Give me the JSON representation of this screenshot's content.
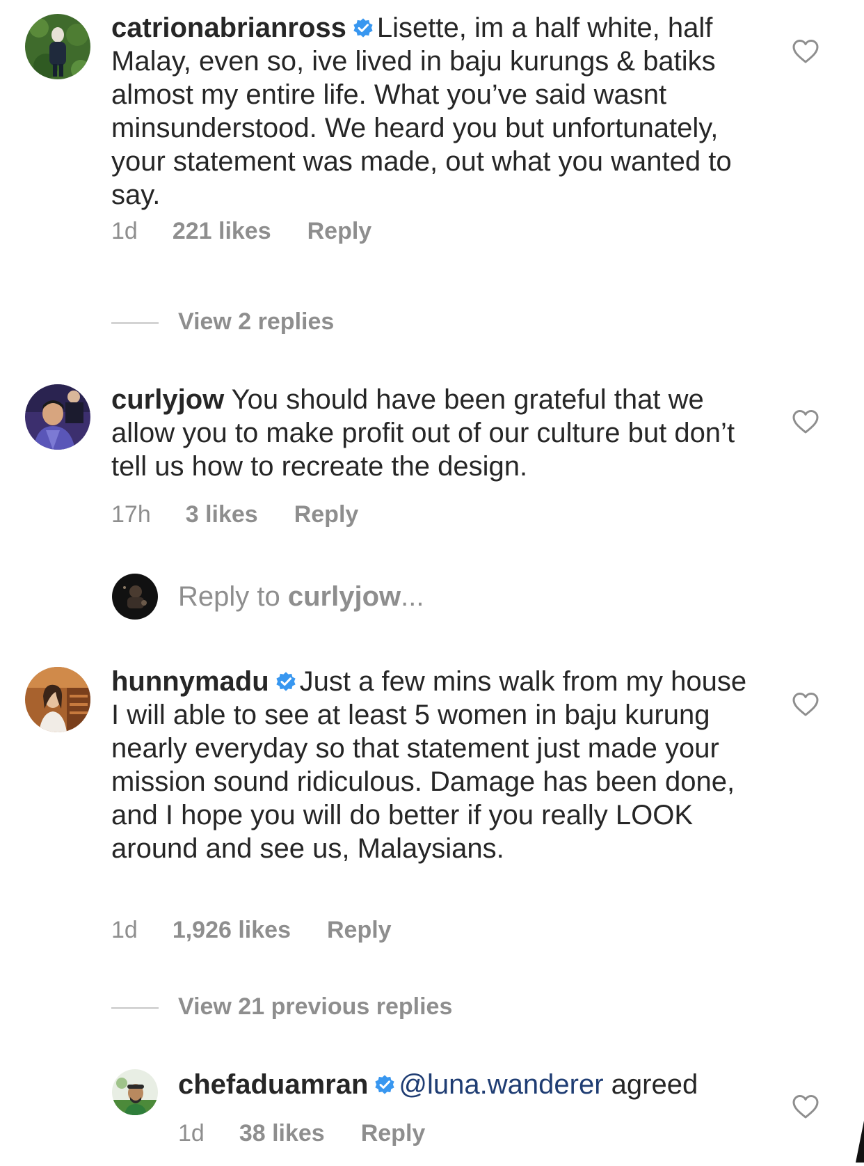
{
  "comments": [
    {
      "username": "catrionabrianross",
      "verified": true,
      "text": "Lisette, im a half white, half Malay, even so, ive lived in baju kurungs & batiks almost my entire life. What you’ve said wasnt minsunderstood. We heard you but unfortunately, your statement was made, out what you wanted to say.",
      "time": "1d",
      "likes": "221 likes",
      "reply_label": "Reply"
    },
    {
      "username": "curlyjow",
      "verified": false,
      "text": "You should have been grateful that we allow you to make profit out of our culture but don’t tell us how to recreate the design.",
      "time": "17h",
      "likes": "3 likes",
      "reply_label": "Reply"
    },
    {
      "username": "hunnymadu",
      "verified": true,
      "text": "Just a few mins walk from my house I will able to see at least 5 women in baju kurung nearly everyday so that statement just made your mission sound ridiculous. Damage has been done, and I hope you will do better if you really LOOK around and see us, Malaysians.",
      "time": "1d",
      "likes": "1,926 likes",
      "reply_label": "Reply"
    }
  ],
  "view_replies_1": "View 2 replies",
  "reply_to": {
    "prefix": "Reply to ",
    "username": "curlyjow",
    "suffix": "..."
  },
  "view_replies_2": "View 21 previous replies",
  "nested_reply": {
    "username": "chefaduamran",
    "verified": true,
    "mention": "@luna.wanderer",
    "text": " agreed",
    "time": "1d",
    "likes": "38 likes",
    "reply_label": "Reply"
  },
  "colors": {
    "verified_blue": "#3897f0",
    "mention_blue": "#1f3d73",
    "secondary_gray": "#8e8e8e",
    "primary_text": "#262626"
  },
  "icons": {
    "like": "heart-outline-icon",
    "verified": "verified-badge-icon"
  }
}
